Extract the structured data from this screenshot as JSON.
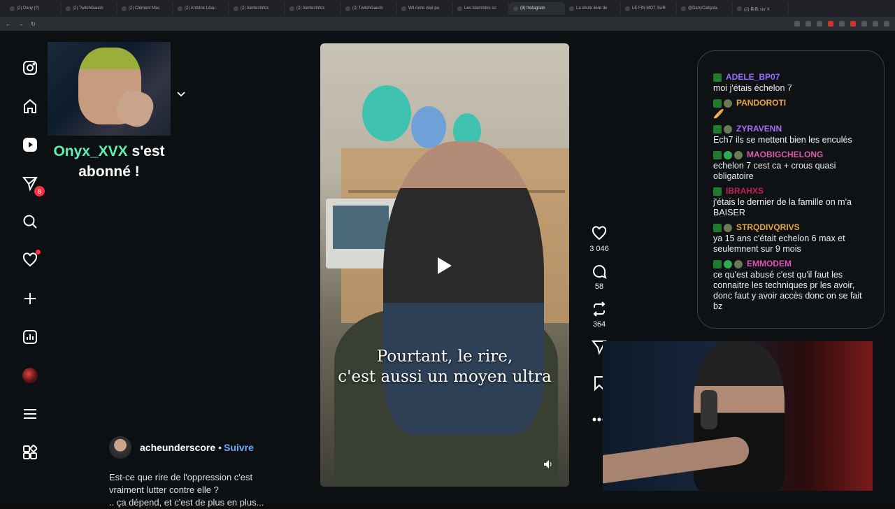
{
  "browser": {
    "tabs": [
      {
        "label": "(2) Dany (?)",
        "active": false
      },
      {
        "label": "(2) TwitchGauch",
        "active": false
      },
      {
        "label": "(2) Clément Mac",
        "active": false
      },
      {
        "label": "(2) Antoine Léau",
        "active": false
      },
      {
        "label": "(2) AlertesInfos",
        "active": false
      },
      {
        "label": "(2) AlertesInfos",
        "active": false
      },
      {
        "label": "(2) TwitchGauch",
        "active": false
      },
      {
        "label": "Wil Aime visé pa",
        "active": false
      },
      {
        "label": "Les islamistes so",
        "active": false
      },
      {
        "label": "(8) Instagram",
        "active": true
      },
      {
        "label": "La chute libre de",
        "active": false
      },
      {
        "label": "LE FIN MOT SUR",
        "active": false
      },
      {
        "label": "@DanyCaligula",
        "active": false
      },
      {
        "label": "(2) 色色 sur X",
        "active": false
      }
    ]
  },
  "sidebar": {
    "messages_badge": "8"
  },
  "overlay": {
    "username": "Onyx_XVX",
    "line1_suffix": "s'est",
    "line2": "abonné !"
  },
  "post": {
    "author": "acheunderscore",
    "separator": "•",
    "follow_label": "Suivre",
    "caption_lines": [
      "Est-ce que rire de l'oppression c'est",
      "vraiment lutter contre elle ?",
      ".. ça dépend, et c'est de plus en plus..."
    ],
    "subtitle_lines": [
      "Pourtant, le rire,",
      "c'est aussi un moyen ultra"
    ],
    "likes": "3 046",
    "comments": "58",
    "reposts": "364"
  },
  "chat": {
    "messages": [
      {
        "user": "ADELE_BP07",
        "color": "#9a6cff",
        "badges": [
          "k"
        ],
        "text": "moi j'étais échelon 7"
      },
      {
        "user": "PANDOROTI",
        "color": "#f2a22e",
        "badges": [
          "k",
          "s"
        ],
        "text": "🥖"
      },
      {
        "user": "ZYRAVENN",
        "color": "#a86cf7",
        "badges": [
          "k",
          "s"
        ],
        "text": "Ech7 ils se mettent bien les enculés"
      },
      {
        "user": "MAOBIGCHELONG",
        "color": "#d95aa9",
        "badges": [
          "k",
          "g",
          "s"
        ],
        "text": "echelon 7 cest ca + crous quasi obligatoire"
      },
      {
        "user": "IBRAHXS",
        "color": "#c02050",
        "badges": [
          "k"
        ],
        "text": "j'étais le dernier de la famille on m'a BAISER"
      },
      {
        "user": "STRQDIVQRIVS",
        "color": "#e6a43a",
        "badges": [
          "k",
          "s"
        ],
        "text": "ya 15 ans c'était echelon 6 max et seulemnent sur 9 mois"
      },
      {
        "user": "EMMODEM",
        "color": "#e04fb5",
        "badges": [
          "k",
          "g",
          "s"
        ],
        "text": "ce qu'est abusé c'est qu'il faut les connaitre les techniques pr les avoir, donc faut y avoir accès donc on se fait bz"
      }
    ]
  }
}
